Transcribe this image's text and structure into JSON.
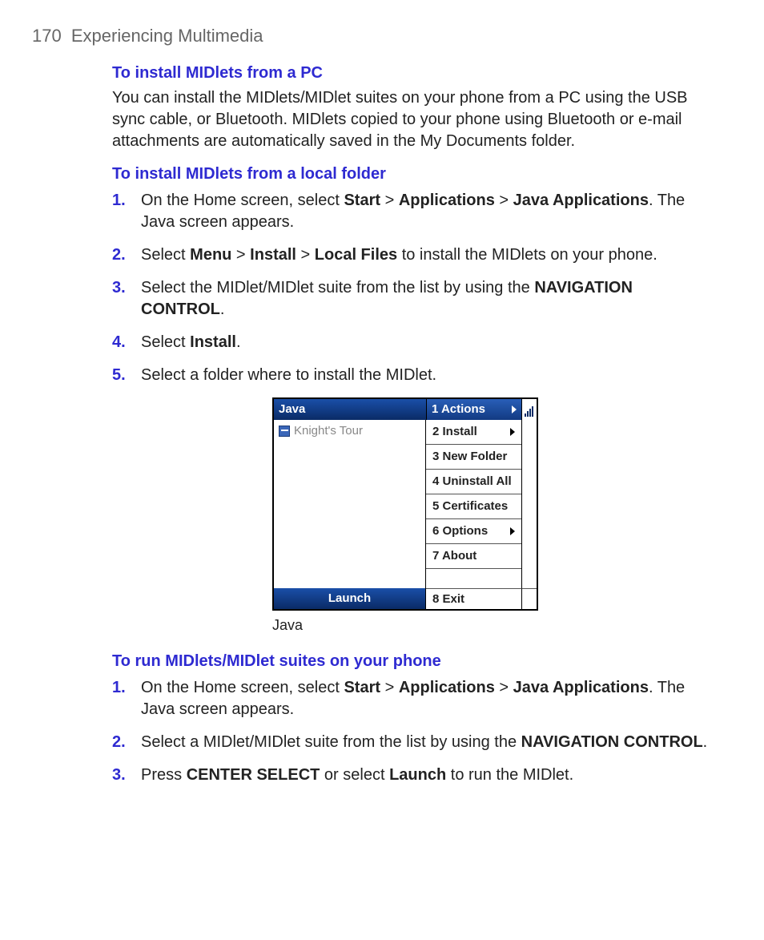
{
  "header": {
    "page_number": "170",
    "chapter_title": "Experiencing Multimedia"
  },
  "section1": {
    "title": "To install MIDlets from a PC",
    "body": "You can install the MIDlets/MIDlet suites on your phone from a PC using the USB sync cable, or Bluetooth. MIDlets copied to your phone using Bluetooth or e-mail attachments are automatically saved in the My Documents folder."
  },
  "section2": {
    "title": "To install MIDlets from a local folder",
    "steps": [
      {
        "num": "1.",
        "pre": "On the Home screen, select ",
        "b1": "Start",
        "sep1": " > ",
        "b2": "Applications",
        "sep2": " > ",
        "b3": "Java Applications",
        "post": ".  The Java screen appears."
      },
      {
        "num": "2.",
        "pre": "Select ",
        "b1": "Menu",
        "sep1": " > ",
        "b2": "Install",
        "sep2": " > ",
        "b3": "Local Files",
        "post": " to install the MIDlets on your phone."
      },
      {
        "num": "3.",
        "pre": "Select the MIDlet/MIDlet suite from the list by using the ",
        "b1": "NAVIGATION CONTROL",
        "post": "."
      },
      {
        "num": "4.",
        "pre": "Select ",
        "b1": "Install",
        "post": "."
      },
      {
        "num": "5.",
        "pre": "Select a folder where to install the MIDlet.",
        "b1": "",
        "post": ""
      }
    ]
  },
  "phone": {
    "title_left": "Java",
    "title_right": "1 Actions",
    "list_item": "Knight's Tour",
    "menu": [
      {
        "label": "2 Install",
        "arrow": true
      },
      {
        "label": "3 New Folder",
        "arrow": false
      },
      {
        "label": "4 Uninstall All",
        "arrow": false
      },
      {
        "label": "5 Certificates",
        "arrow": false
      },
      {
        "label": "6 Options",
        "arrow": true
      },
      {
        "label": "7 About",
        "arrow": false
      }
    ],
    "footer_left": "Launch",
    "footer_right": "8 Exit",
    "caption": "Java"
  },
  "section3": {
    "title": "To run MIDlets/MIDlet suites on your phone",
    "steps": [
      {
        "num": "1.",
        "pre": "On the Home screen, select ",
        "b1": "Start",
        "sep1": " > ",
        "b2": "Applications",
        "sep2": " > ",
        "b3": "Java Applications",
        "post": ". The Java screen appears."
      },
      {
        "num": "2.",
        "pre": "Select a MIDlet/MIDlet suite from the list by using the ",
        "b1": "NAVIGATION CONTROL",
        "post": "."
      },
      {
        "num": "3.",
        "pre": "Press ",
        "b1": "CENTER SELECT",
        "mid": " or select ",
        "b2": "Launch",
        "post": " to run the MIDlet."
      }
    ]
  }
}
